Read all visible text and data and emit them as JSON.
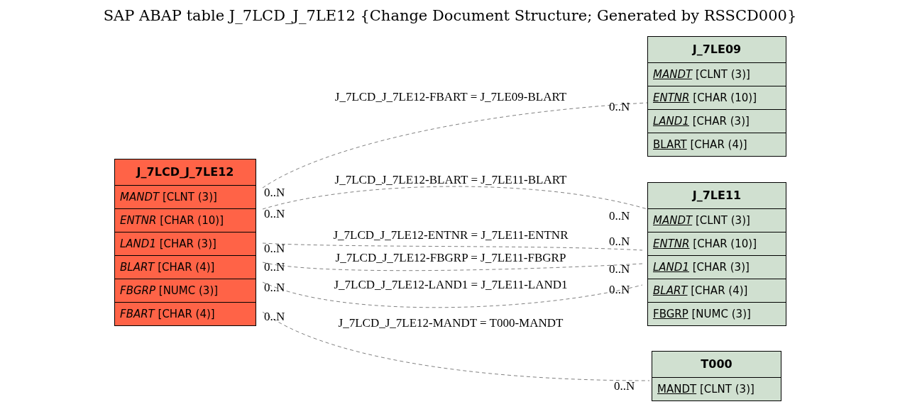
{
  "title": "SAP ABAP table J_7LCD_J_7LE12 {Change Document Structure; Generated by RSSCD000}",
  "tables": [
    {
      "name": "J_7LCD_J_7LE12",
      "color": "#ff6347",
      "fields": [
        {
          "name": "MANDT",
          "type": "[CLNT (3)]",
          "key": false,
          "italic": true
        },
        {
          "name": "ENTNR",
          "type": "[CHAR (10)]",
          "key": false,
          "italic": true
        },
        {
          "name": "LAND1",
          "type": "[CHAR (3)]",
          "key": false,
          "italic": true
        },
        {
          "name": "BLART",
          "type": "[CHAR (4)]",
          "key": false,
          "italic": true
        },
        {
          "name": "FBGRP",
          "type": "[NUMC (3)]",
          "key": false,
          "italic": true
        },
        {
          "name": "FBART",
          "type": "[CHAR (4)]",
          "key": false,
          "italic": true
        }
      ]
    },
    {
      "name": "J_7LE09",
      "color": "#d0e0d0",
      "fields": [
        {
          "name": "MANDT",
          "type": "[CLNT (3)]",
          "key": true,
          "italic": true
        },
        {
          "name": "ENTNR",
          "type": "[CHAR (10)]",
          "key": true,
          "italic": true
        },
        {
          "name": "LAND1",
          "type": "[CHAR (3)]",
          "key": true,
          "italic": true
        },
        {
          "name": "BLART",
          "type": "[CHAR (4)]",
          "key": true,
          "italic": false
        }
      ]
    },
    {
      "name": "J_7LE11",
      "color": "#d0e0d0",
      "fields": [
        {
          "name": "MANDT",
          "type": "[CLNT (3)]",
          "key": true,
          "italic": true
        },
        {
          "name": "ENTNR",
          "type": "[CHAR (10)]",
          "key": true,
          "italic": true
        },
        {
          "name": "LAND1",
          "type": "[CHAR (3)]",
          "key": true,
          "italic": true
        },
        {
          "name": "BLART",
          "type": "[CHAR (4)]",
          "key": true,
          "italic": true
        },
        {
          "name": "FBGRP",
          "type": "[NUMC (3)]",
          "key": true,
          "italic": false
        }
      ]
    },
    {
      "name": "T000",
      "color": "#d0e0d0",
      "fields": [
        {
          "name": "MANDT",
          "type": "[CLNT (3)]",
          "key": true,
          "italic": false
        }
      ]
    }
  ],
  "relations": [
    {
      "label": "J_7LCD_J_7LE12-FBART = J_7LE09-BLART",
      "from_card": "0..N",
      "to_card": "0..N"
    },
    {
      "label": "J_7LCD_J_7LE12-BLART = J_7LE11-BLART",
      "from_card": "0..N",
      "to_card": "0..N"
    },
    {
      "label": "J_7LCD_J_7LE12-ENTNR = J_7LE11-ENTNR",
      "from_card": "0..N",
      "to_card": "0..N"
    },
    {
      "label": "J_7LCD_J_7LE12-FBGRP = J_7LE11-FBGRP",
      "from_card": "0..N",
      "to_card": "0..N"
    },
    {
      "label": "J_7LCD_J_7LE12-LAND1 = J_7LE11-LAND1",
      "from_card": "0..N",
      "to_card": "0..N"
    },
    {
      "label": "J_7LCD_J_7LE12-MANDT = T000-MANDT",
      "from_card": "0..N",
      "to_card": "0..N"
    }
  ]
}
